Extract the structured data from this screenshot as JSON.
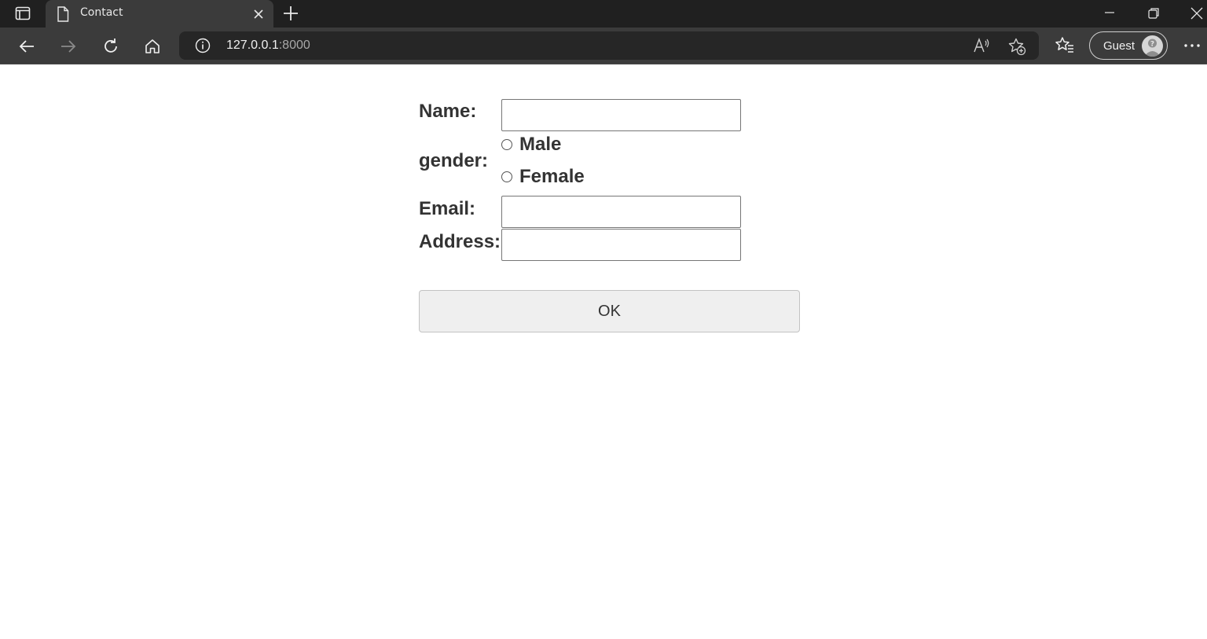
{
  "browser": {
    "tab_title": "Contact",
    "url_host": "127.0.0.1",
    "url_port": ":8000",
    "profile_label": "Guest",
    "icons": {
      "tab_actions": "tab-actions-icon",
      "page": "page-icon",
      "close": "close-icon",
      "new_tab": "plus-icon",
      "back": "back-arrow-icon",
      "forward": "forward-arrow-icon",
      "refresh": "refresh-icon",
      "home": "home-icon",
      "info": "info-icon",
      "read_aloud": "read-aloud-icon",
      "add_favorite": "star-plus-icon",
      "favorites": "favorites-icon",
      "more": "more-icon"
    }
  },
  "form": {
    "name_label": "Name:",
    "gender_label": "gender:",
    "gender_options": [
      "Male",
      "Female"
    ],
    "email_label": "Email:",
    "address_label": "Address:",
    "submit_label": "OK"
  }
}
